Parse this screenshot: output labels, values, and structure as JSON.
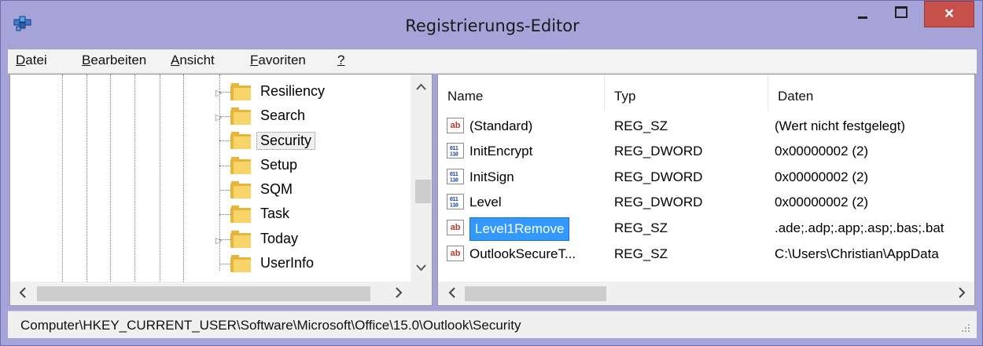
{
  "window": {
    "title": "Registrierungs-Editor",
    "close_label": "×"
  },
  "menu": [
    {
      "key": "D",
      "rest": "atei"
    },
    {
      "key": "B",
      "rest": "earbeiten"
    },
    {
      "key": "A",
      "rest": "nsicht"
    },
    {
      "key": "F",
      "rest": "avoriten"
    },
    {
      "key": "?",
      "rest": ""
    }
  ],
  "tree": {
    "items": [
      {
        "label": "Resiliency",
        "expandable": true
      },
      {
        "label": "Search",
        "expandable": true
      },
      {
        "label": "Security",
        "expandable": false,
        "selected": true
      },
      {
        "label": "Setup",
        "expandable": false
      },
      {
        "label": "SQM",
        "expandable": false
      },
      {
        "label": "Task",
        "expandable": false
      },
      {
        "label": "Today",
        "expandable": true
      },
      {
        "label": "UserInfo",
        "expandable": false
      }
    ],
    "expander_glyph": "▷"
  },
  "list": {
    "columns": {
      "name": "Name",
      "type": "Typ",
      "data": "Daten"
    },
    "rows": [
      {
        "icon": "string-value-icon",
        "name": "(Standard)",
        "type": "REG_SZ",
        "data": "(Wert nicht festgelegt)"
      },
      {
        "icon": "binary-value-icon",
        "name": "InitEncrypt",
        "type": "REG_DWORD",
        "data": "0x00000002 (2)"
      },
      {
        "icon": "binary-value-icon",
        "name": "InitSign",
        "type": "REG_DWORD",
        "data": "0x00000002 (2)"
      },
      {
        "icon": "binary-value-icon",
        "name": "Level",
        "type": "REG_DWORD",
        "data": "0x00000002 (2)"
      },
      {
        "icon": "string-value-icon",
        "name": "Level1Remove",
        "type": "REG_SZ",
        "data": ".ade;.adp;.app;.asp;.bas;.bat",
        "selected": true
      },
      {
        "icon": "string-value-icon",
        "name": "OutlookSecureT...",
        "type": "REG_SZ",
        "data": "C:\\Users\\Christian\\AppData"
      }
    ]
  },
  "icons": {
    "string_glyph": "ab",
    "binary_glyph": "011\n110"
  },
  "status": {
    "path": "Computer\\HKEY_CURRENT_USER\\Software\\Microsoft\\Office\\15.0\\Outlook\\Security"
  },
  "colors": {
    "frame": "#a6a3d8",
    "close_button": "#c7514a",
    "selection": "#3399ff",
    "folder": "#e7b53c"
  }
}
